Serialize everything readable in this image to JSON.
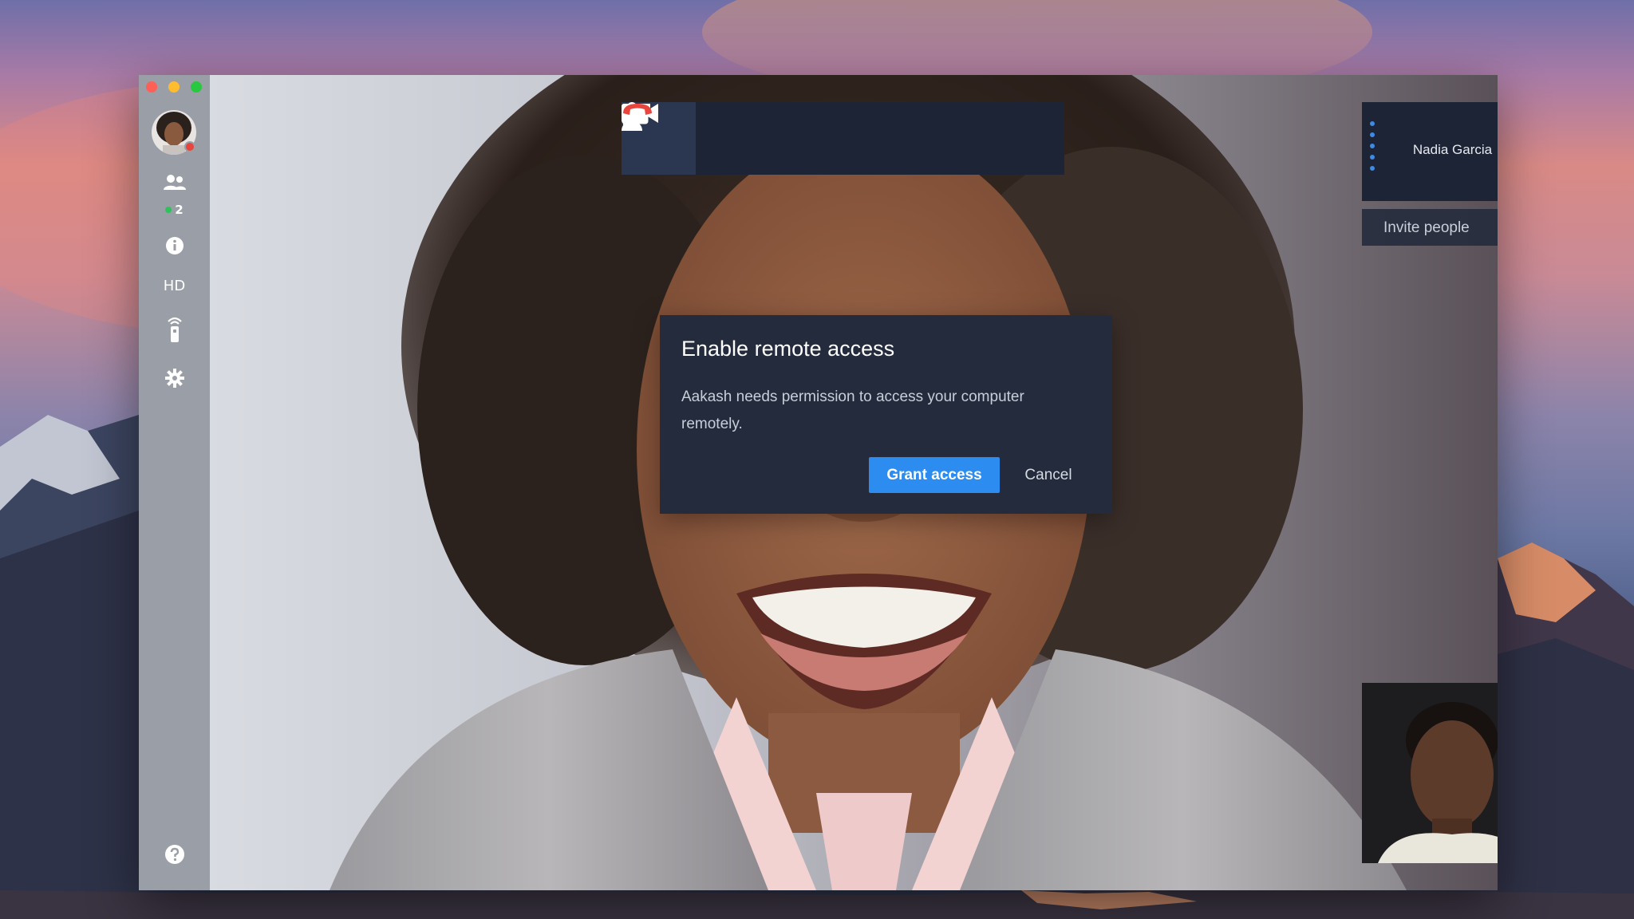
{
  "window": {
    "traffic_lights": [
      "close",
      "minimize",
      "maximize"
    ]
  },
  "rail": {
    "avatar_icon": "user-avatar",
    "participants_icon": "people-icon",
    "participants_count": "2",
    "info_icon": "info-icon",
    "hd_label": "HD",
    "remote_icon": "remote-control-icon",
    "settings_icon": "gear-icon",
    "help_icon": "help-icon"
  },
  "toolbar": {
    "buttons": [
      "video-camera-icon",
      "microphone-icon",
      "add-person-icon",
      "screen-share-icon",
      "fullscreen-icon",
      "hang-up-icon"
    ],
    "hangup_color": "#e8453c"
  },
  "participants": {
    "name": "Nadia Garcia",
    "invite_label": "Invite people"
  },
  "dialog": {
    "title": "Enable remote access",
    "body": "Aakash needs permission to access your computer remotely.",
    "primary_button": "Grant access",
    "secondary_button": "Cancel"
  },
  "colors": {
    "primary": "#2d8cf0",
    "panel": "#1c2436",
    "rail": "#9a9ea6"
  }
}
